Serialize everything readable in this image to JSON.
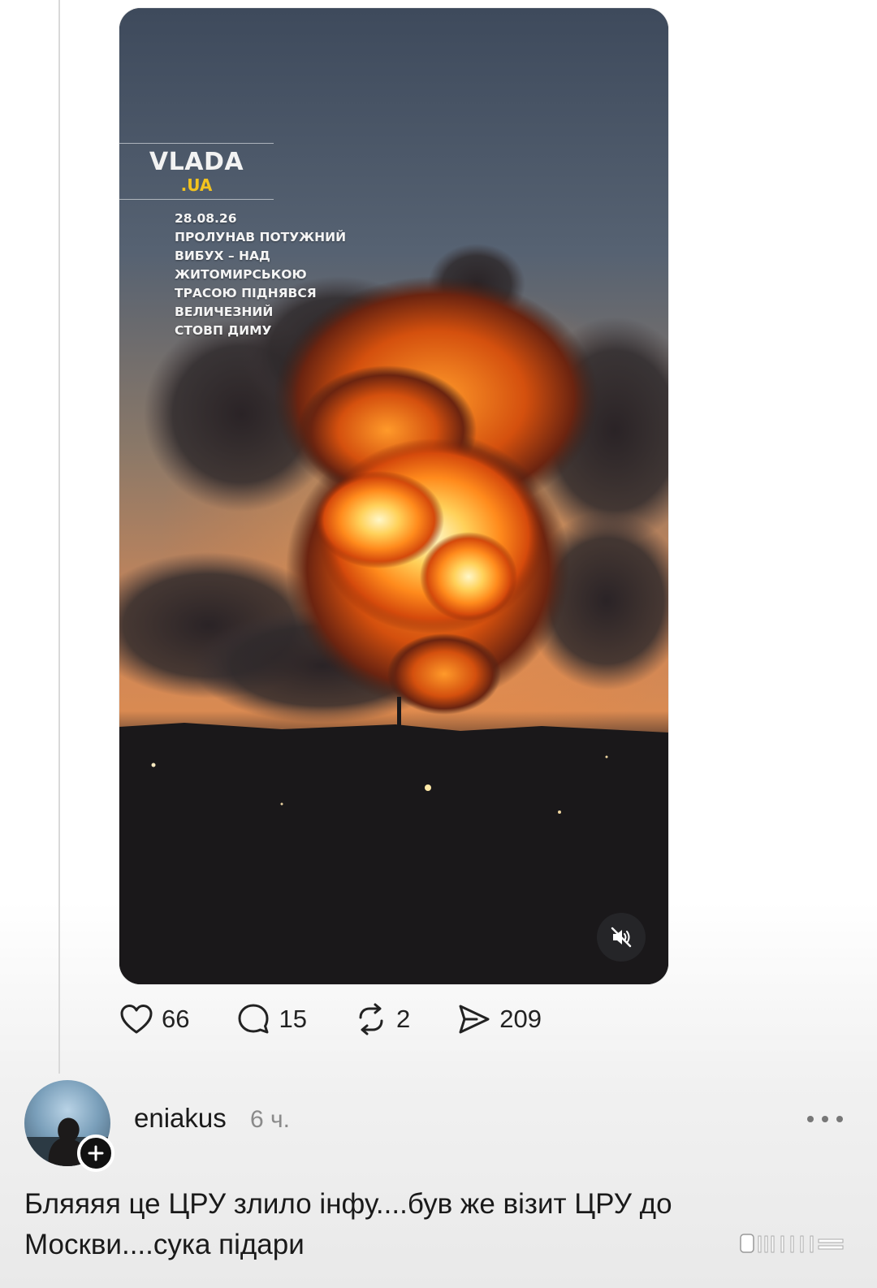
{
  "post": {
    "media": {
      "brand_name": "VLADA",
      "brand_suffix": ".UA",
      "date": "28.08.26",
      "headline_lines": [
        "ПРОЛУНАВ ПОТУЖНИЙ",
        "ВИБУХ – НАД",
        "ЖИТОМИРСЬКОЮ",
        "ТРАСОЮ ПІДНЯВСЯ",
        "ВЕЛИЧЕЗНИЙ",
        "СТОВП ДИМУ"
      ],
      "mute_icon": "speaker-muted-icon"
    },
    "actions": {
      "likes": "66",
      "comments": "15",
      "reposts": "2",
      "shares": "209"
    }
  },
  "reply": {
    "username": "eniakus",
    "timestamp": "6 ч.",
    "text_line1": "Бляяяя це ЦРУ злило інфу....був же візит ЦРУ до",
    "text_line2": "Москви....сука підари"
  },
  "colors": {
    "brand_suffix": "#f3c31e",
    "text_primary": "#1a1a1a",
    "text_secondary": "#8a8a8a"
  }
}
